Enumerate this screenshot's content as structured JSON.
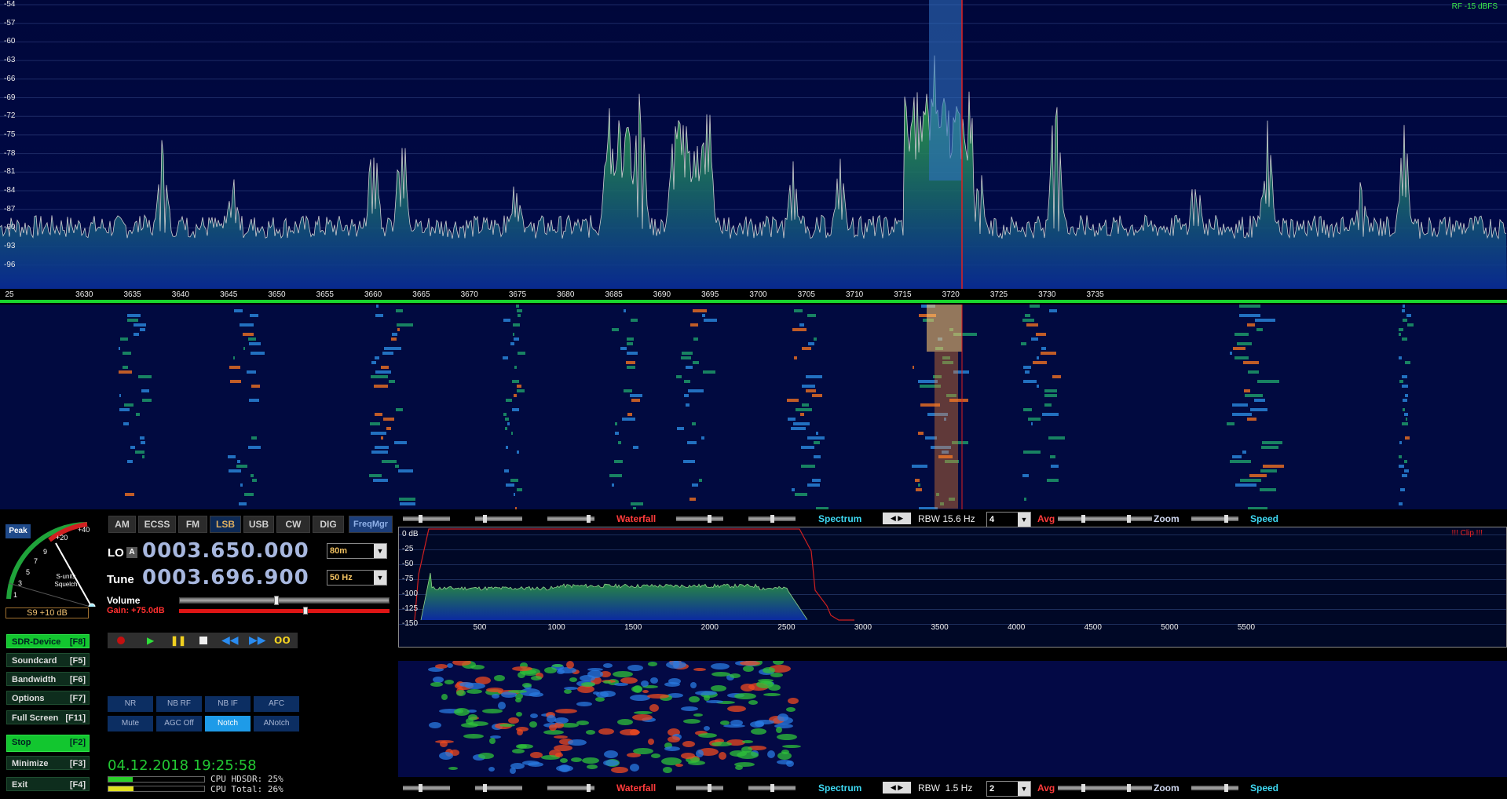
{
  "spectrum": {
    "rf_label": "RF -15 dBFS",
    "y_labels": [
      "-54",
      "-57",
      "-60",
      "-63",
      "-66",
      "-69",
      "-72",
      "-75",
      "-78",
      "-81",
      "-84",
      "-87",
      "-90",
      "-93",
      "-96"
    ],
    "freq_labels": [
      "25",
      "3630",
      "3635",
      "3640",
      "3645",
      "3650",
      "3655",
      "3660",
      "3665",
      "3670",
      "3675",
      "3680",
      "3685",
      "3690",
      "3695",
      "3700",
      "3705",
      "3710",
      "3715",
      "3720",
      "3725",
      "3730",
      "3735"
    ]
  },
  "smeter": {
    "peak_label": "Peak",
    "scale": [
      "1",
      "3",
      "5",
      "7",
      "9",
      "+20",
      "+40"
    ],
    "caption": "S-units\nSquelch",
    "reading": "S9 +10 dB"
  },
  "modes": {
    "items": [
      "AM",
      "ECSS",
      "FM",
      "LSB",
      "USB",
      "CW",
      "DIG"
    ],
    "active": "LSB",
    "freqmgr": "FreqMgr"
  },
  "lo": {
    "label": "LO",
    "badge": "A",
    "value": "0003.650.000",
    "band": "80m"
  },
  "tune": {
    "label": "Tune",
    "value": "0003.696.900",
    "step": "50 Hz"
  },
  "volume": {
    "label": "Volume",
    "gain": "Gain: +75.0dB"
  },
  "left_buttons": [
    {
      "label": "SDR-Device",
      "key": "[F8]",
      "on": true
    },
    {
      "label": "Soundcard",
      "key": "[F5]",
      "on": false
    },
    {
      "label": "Bandwidth",
      "key": "[F6]",
      "on": false
    },
    {
      "label": "Options",
      "key": "[F7]",
      "on": false
    },
    {
      "label": "Full Screen",
      "key": "[F11]",
      "on": false
    },
    {
      "label": "Stop",
      "key": "[F2]",
      "on": true
    },
    {
      "label": "Minimize",
      "key": "[F3]",
      "on": false
    },
    {
      "label": "Exit",
      "key": "[F4]",
      "on": false
    }
  ],
  "dsp": {
    "row1": [
      "NR",
      "NB RF",
      "NB IF",
      "AFC"
    ],
    "row2": [
      "Mute",
      "AGC Off",
      "Notch",
      "ANotch"
    ],
    "active": "Notch"
  },
  "status": {
    "datetime": "04.12.2018 19:25:58",
    "cpu_hdsdr": "CPU HDSDR: 25%",
    "cpu_total": "CPU Total: 26%"
  },
  "controls_top": {
    "waterfall": "Waterfall",
    "spectrum": "Spectrum",
    "rbw": "RBW 15.6 Hz",
    "avg_value": "4",
    "avg": "Avg",
    "zoom": "Zoom",
    "speed": "Speed"
  },
  "controls_bottom": {
    "waterfall": "Waterfall",
    "spectrum": "Spectrum",
    "rbw": "RBW  1.5 Hz",
    "avg_value": "2",
    "avg": "Avg",
    "zoom": "Zoom",
    "speed": "Speed"
  },
  "af": {
    "clip": "!!! Clip !!!",
    "y_labels": [
      "0 dB",
      "-25",
      "-50",
      "-75",
      "-100",
      "-125",
      "-150"
    ],
    "x_labels": [
      "500",
      "1000",
      "1500",
      "2000",
      "2500",
      "3000",
      "3500",
      "4000",
      "4500",
      "5000",
      "5500"
    ]
  },
  "colors": {
    "accent_green": "#12c62f",
    "waterfall_label": "#ff3b3b",
    "spectrum_label": "#3ed8f2",
    "gain_red": "#ff2a2a"
  }
}
